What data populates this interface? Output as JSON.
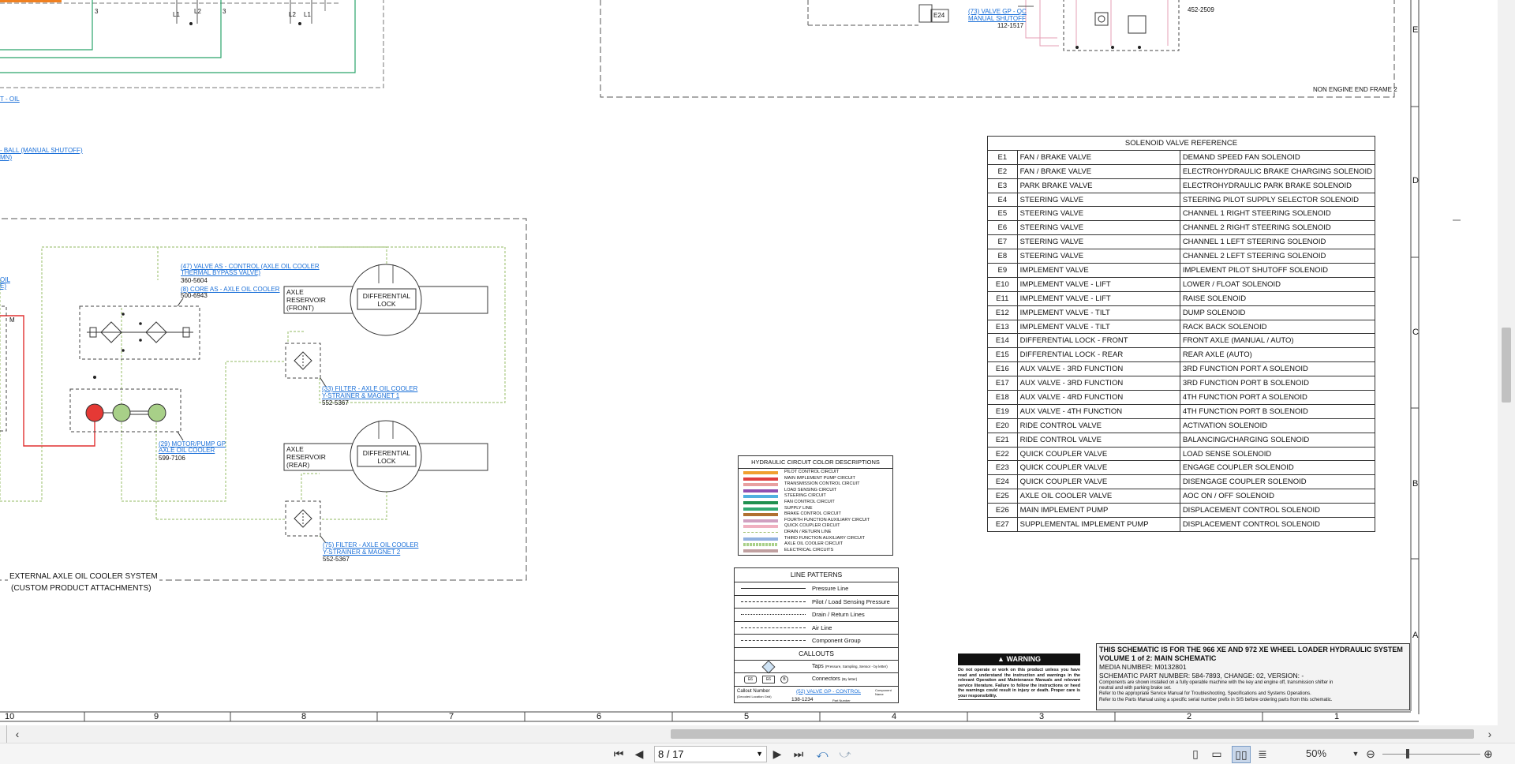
{
  "callouts": {
    "oil": "T - OIL",
    "ball_1": "- BALL (MANUAL SHUTOFF)",
    "ball_2": "MN)",
    "left_partial_1": "OIL",
    "left_partial_2": "E)",
    "valve_ctrl_1": "(47) VALVE AS - CONTROL (AXLE OIL COOLER",
    "valve_ctrl_2": "THERMAL BYPASS VALVE)",
    "valve_ctrl_pn": "360-5604",
    "core_1": "(8) CORE AS - AXLE OIL COOLER",
    "core_pn": "500-6943",
    "filter1_1": "(33) FILTER - AXLE OIL COOLER",
    "filter1_2": "Y-STRAINER & MAGNET 1",
    "filter1_pn": "552-5367",
    "motor_1": "(29) MOTOR/PUMP GP",
    "motor_2": "AXLE OIL COOLER",
    "motor_pn": "599-7106",
    "filter2_1": "(75) FILTER - AXLE OIL COOLER",
    "filter2_2": "Y-STRAINER & MAGNET 2",
    "filter2_pn": "552-5367",
    "valve_gp_1": "(73) VALVE GP - QC",
    "valve_gp_2": "MANUAL SHUTOFF",
    "valve_gp_pn": "112-1517",
    "top_right_pn": "452-2509",
    "e24": "E24",
    "l1": "L1",
    "l2": "L2",
    "num3": "3",
    "m": "M"
  },
  "labels": {
    "axle_res_front_1": "AXLE",
    "axle_res_front_2": "RESERVOIR",
    "axle_res_front_3": "(FRONT)",
    "axle_res_rear_1": "AXLE",
    "axle_res_rear_2": "RESERVOIR",
    "axle_res_rear_3": "(REAR)",
    "diff_lock_1": "DIFFERENTIAL",
    "diff_lock_2": "LOCK",
    "ext_system_1": "EXTERNAL AXLE OIL COOLER SYSTEM",
    "ext_system_2": "(CUSTOM PRODUCT ATTACHMENTS)",
    "frame": "NON ENGINE END FRAME 2"
  },
  "solenoid_table": {
    "title": "SOLENOID VALVE REFERENCE",
    "rows": [
      [
        "E1",
        "FAN / BRAKE VALVE",
        "DEMAND SPEED FAN SOLENOID"
      ],
      [
        "E2",
        "FAN / BRAKE VALVE",
        "ELECTROHYDRAULIC BRAKE CHARGING SOLENOID"
      ],
      [
        "E3",
        "PARK BRAKE VALVE",
        "ELECTROHYDRAULIC PARK BRAKE SOLENOID"
      ],
      [
        "E4",
        "STEERING VALVE",
        "STEERING PILOT SUPPLY SELECTOR SOLENOID"
      ],
      [
        "E5",
        "STEERING VALVE",
        "CHANNEL 1 RIGHT STEERING SOLENOID"
      ],
      [
        "E6",
        "STEERING VALVE",
        "CHANNEL 2 RIGHT STEERING SOLENOID"
      ],
      [
        "E7",
        "STEERING VALVE",
        "CHANNEL 1 LEFT STEERING SOLENOID"
      ],
      [
        "E8",
        "STEERING VALVE",
        "CHANNEL 2 LEFT STEERING SOLENOID"
      ],
      [
        "E9",
        "IMPLEMENT VALVE",
        "IMPLEMENT PILOT SHUTOFF SOLENOID"
      ],
      [
        "E10",
        "IMPLEMENT VALVE - LIFT",
        "LOWER / FLOAT SOLENOID"
      ],
      [
        "E11",
        "IMPLEMENT VALVE - LIFT",
        "RAISE SOLENOID"
      ],
      [
        "E12",
        "IMPLEMENT VALVE - TILT",
        "DUMP SOLENOID"
      ],
      [
        "E13",
        "IMPLEMENT VALVE - TILT",
        "RACK BACK SOLENOID"
      ],
      [
        "E14",
        "DIFFERENTIAL LOCK - FRONT",
        "FRONT AXLE (MANUAL / AUTO)"
      ],
      [
        "E15",
        "DIFFERENTIAL LOCK - REAR",
        "REAR AXLE (AUTO)"
      ],
      [
        "E16",
        "AUX VALVE - 3RD FUNCTION",
        "3RD FUNCTION PORT A SOLENOID"
      ],
      [
        "E17",
        "AUX VALVE - 3RD FUNCTION",
        "3RD FUNCTION PORT B SOLENOID"
      ],
      [
        "E18",
        "AUX VALVE - 4RD FUNCTION",
        "4TH FUNCTION PORT A SOLENOID"
      ],
      [
        "E19",
        "AUX VALVE - 4TH FUNCTION",
        "4TH FUNCTION PORT B SOLENOID"
      ],
      [
        "E20",
        "RIDE CONTROL VALVE",
        "ACTIVATION SOLENOID"
      ],
      [
        "E21",
        "RIDE CONTROL VALVE",
        "BALANCING/CHARGING SOLENOID"
      ],
      [
        "E22",
        "QUICK COUPLER VALVE",
        "LOAD SENSE SOLENOID"
      ],
      [
        "E23",
        "QUICK COUPLER VALVE",
        "ENGAGE COUPLER SOLENOID"
      ],
      [
        "E24",
        "QUICK COUPLER VALVE",
        "DISENGAGE COUPLER SOLENOID"
      ],
      [
        "E25",
        "AXLE OIL COOLER VALVE",
        "AOC ON / OFF SOLENOID"
      ],
      [
        "E26",
        "MAIN IMPLEMENT PUMP",
        "DISPLACEMENT CONTROL SOLENOID"
      ],
      [
        "E27",
        "SUPPLEMENTAL IMPLEMENT PUMP",
        "DISPLACEMENT CONTROL SOLENOID"
      ]
    ]
  },
  "color_legend": {
    "title": "HYDRAULIC CIRCUIT COLOR DESCRIPTIONS",
    "items": [
      {
        "label": "PILOT CONTROL CIRCUIT",
        "color": "#f0a030"
      },
      {
        "label": "MAIN IMPLEMENT PUMP CIRCUIT",
        "color": "#e04040"
      },
      {
        "label": "TRANSMISSION CONTROL CIRCUIT",
        "color": "#e8a0a0"
      },
      {
        "label": "LOAD SENSING CIRCUIT",
        "color": "#9050b0"
      },
      {
        "label": "STEERING CIRCUIT",
        "color": "#50b0e0"
      },
      {
        "label": "FAN CONTROL CIRCUIT",
        "color": "#209050"
      },
      {
        "label": "SUPPLY LINE",
        "color": "#30a870"
      },
      {
        "label": "BRAKE CONTROL CIRCUIT",
        "color": "#b07030"
      },
      {
        "label": "FOURTH FUNCTION AUXILIARY CIRCUIT",
        "color": "#d0a0c0"
      },
      {
        "label": "QUICK COUPLER CIRCUIT",
        "color": "#f0b0c0"
      },
      {
        "label": "DRAIN / RETURN LINE",
        "color": "#a0c070"
      },
      {
        "label": "THIRD FUNCTION AUXILIARY CIRCUIT",
        "color": "#90b0e0"
      },
      {
        "label": "AXLE OIL COOLER CIRCUIT",
        "color": "#a8d088"
      },
      {
        "label": "ELECTRICAL CIRCUITS",
        "color": "#c0a0a0"
      }
    ]
  },
  "line_patterns": {
    "title": "LINE PATTERNS",
    "items": [
      "Pressure Line",
      "Pilot / Load Sensing Pressure",
      "Drain / Return Lines",
      "Air Line",
      "Component Group"
    ],
    "callouts_title": "CALLOUTS",
    "taps": "Taps",
    "taps_sub": "(Pressure, Sampling, Sensor - by letter)",
    "connectors": "Connectors",
    "connectors_sub": "(By letter)",
    "callout_number": "Callout Number",
    "callout_number_sub": "(Decoded Location Grid)",
    "callout_example": "(52) VALVE GP - CONTROL",
    "callout_pn": "138-1234",
    "component_name": "Component Name",
    "part_number": "Part Number"
  },
  "warning": {
    "title": "WARNING",
    "text": "Do not operate or work on this product unless you have read and understand the instruction and warnings in the relevant Operation and Maintenance Manuals and relevant service literature. Failure to follow the instructions or heed the warnings could result in injury or death. Proper care is your responsibility."
  },
  "title_block": {
    "line1": "THIS SCHEMATIC IS FOR THE 966 XE AND 972 XE WHEEL LOADER HYDRAULIC SYSTEM",
    "line2": "VOLUME 1 of 2: MAIN SCHEMATIC",
    "line3": "MEDIA NUMBER: M0132801",
    "line4": "SCHEMATIC PART NUMBER: 584-7893, CHANGE: 02, VERSION: -",
    "line5": "Components are shown installed on a fully operable machine with the key and engine off, transmission shifter in neutral and with parking brake set.",
    "line6": "Refer to the appropriate Service Manual for Troubleshooting, Specifications and Systems Operations.",
    "line7": "Refer to the Parts Manual using a specific serial number prefix in SIS before ordering parts from this schematic."
  },
  "grid": {
    "columns": [
      "10",
      "9",
      "8",
      "7",
      "6",
      "5",
      "4",
      "3",
      "2",
      "1"
    ],
    "rows": [
      "E",
      "D",
      "C",
      "B",
      "A"
    ]
  },
  "toolbar": {
    "page": "8 / 17",
    "zoom": "50%",
    "first_icon": "first-page-icon",
    "prev_icon": "prev-page-icon",
    "next_icon": "next-page-icon",
    "last_icon": "last-page-icon"
  }
}
